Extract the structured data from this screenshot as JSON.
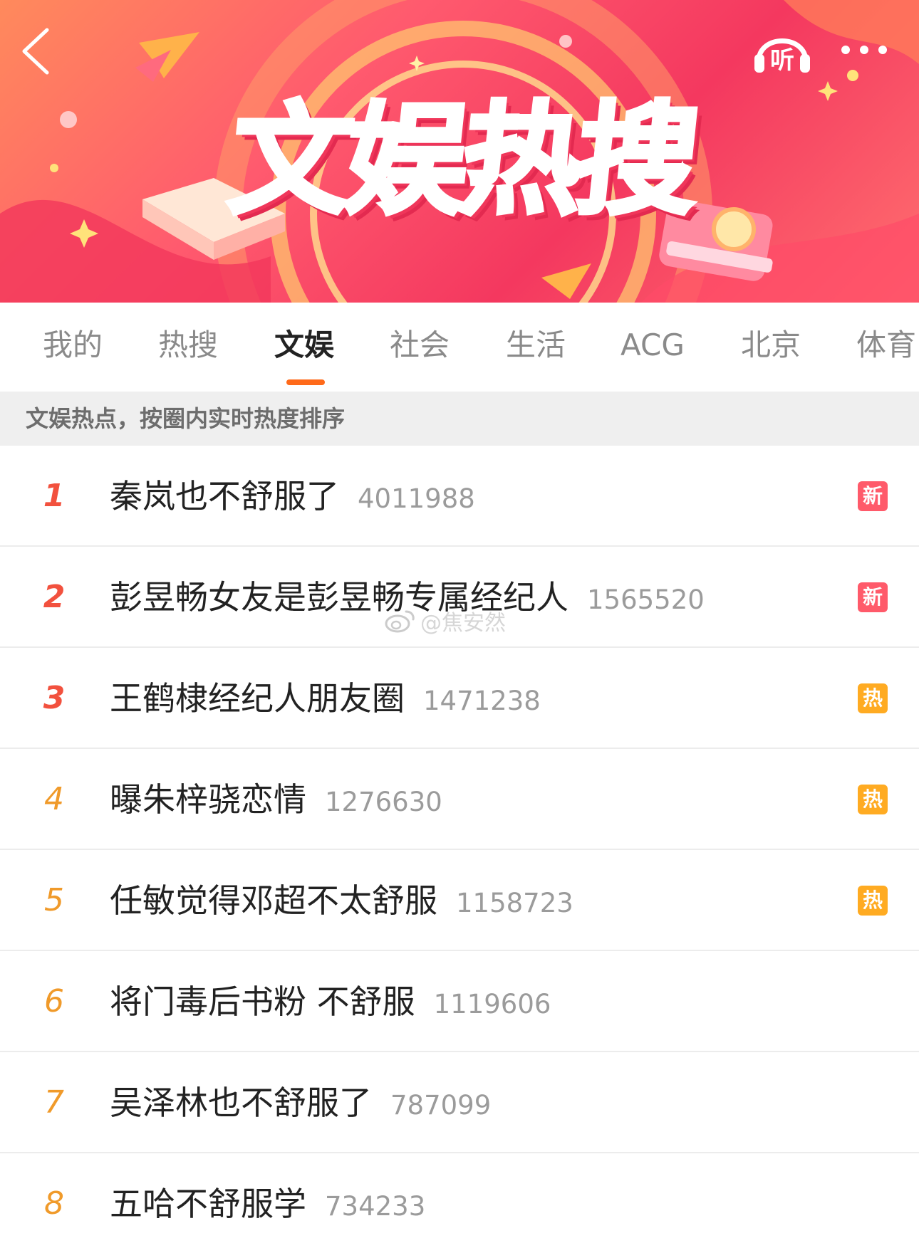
{
  "header": {
    "title": "文娱热搜",
    "listen_label": "听",
    "back_icon": "chevron-left-icon",
    "more_icon": "more-dots-icon"
  },
  "tabs": [
    {
      "label": "我的"
    },
    {
      "label": "热搜"
    },
    {
      "label": "文娱",
      "active": true
    },
    {
      "label": "社会"
    },
    {
      "label": "生活"
    },
    {
      "label": "ACG"
    },
    {
      "label": "北京"
    },
    {
      "label": "体育"
    }
  ],
  "subheader": "文娱热点，按圈内实时热度排序",
  "list": [
    {
      "rank": "1",
      "topic": "秦岚也不舒服了",
      "heat": "4011988",
      "badge": "新",
      "badge_type": "new"
    },
    {
      "rank": "2",
      "topic": "彭昱畅女友是彭昱畅专属经纪人",
      "heat": "1565520",
      "badge": "新",
      "badge_type": "new"
    },
    {
      "rank": "3",
      "topic": "王鹤棣经纪人朋友圈",
      "heat": "1471238",
      "badge": "热",
      "badge_type": "hot"
    },
    {
      "rank": "4",
      "topic": "曝朱梓骁恋情",
      "heat": "1276630",
      "badge": "热",
      "badge_type": "hot"
    },
    {
      "rank": "5",
      "topic": "任敏觉得邓超不太舒服",
      "heat": "1158723",
      "badge": "热",
      "badge_type": "hot"
    },
    {
      "rank": "6",
      "topic": "将门毒后书粉 不舒服",
      "heat": "1119606",
      "badge": "",
      "badge_type": ""
    },
    {
      "rank": "7",
      "topic": "吴泽林也不舒服了",
      "heat": "787099",
      "badge": "",
      "badge_type": ""
    },
    {
      "rank": "8",
      "topic": "五哈不舒服学",
      "heat": "734233",
      "badge": "",
      "badge_type": ""
    }
  ],
  "watermark": "@焦安然",
  "colors": {
    "accent": "#ff6a1a",
    "badge_new": "#ff5a6a",
    "badge_hot": "#ffab22",
    "rank_top": "#f2513e",
    "rank_rest": "#f09a2a"
  }
}
